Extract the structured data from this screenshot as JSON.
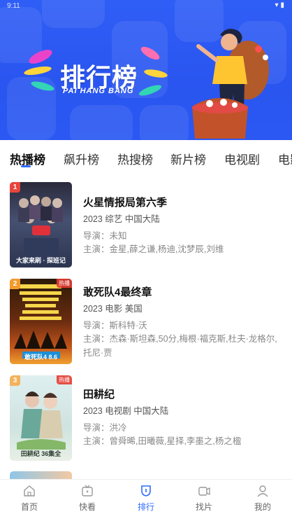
{
  "status_bar": {
    "time": "9:11"
  },
  "banner": {
    "title": "排行榜",
    "subtitle": "PAI HANG BANG"
  },
  "tabs": [
    {
      "label": "热播榜",
      "active": true
    },
    {
      "label": "飙升榜",
      "active": false
    },
    {
      "label": "热搜榜",
      "active": false
    },
    {
      "label": "新片榜",
      "active": false
    },
    {
      "label": "电视剧",
      "active": false
    },
    {
      "label": "电影",
      "active": false
    }
  ],
  "items": [
    {
      "rank": "1",
      "title": "火星情报局第六季",
      "meta": "2023  综艺  中国大陆",
      "director": "导演：未知",
      "cast": "主演：金星,薛之谦,杨迪,沈梦辰,刘维",
      "poster_caption": "大家来刷 · 探班记",
      "badge": ""
    },
    {
      "rank": "2",
      "title": "敢死队4最终章",
      "meta": "2023  电影  美国",
      "director": "导演：斯科特·沃",
      "cast": "主演：杰森·斯坦森,50分,梅根·福克斯,杜夫·龙格尔,托尼·贾",
      "poster_caption": "敢死队4 8.6",
      "badge": "热播"
    },
    {
      "rank": "3",
      "title": "田耕纪",
      "meta": "2023  电视剧  中国大陆",
      "director": "导演：洪冷",
      "cast": "主演：曾舜晞,田曦薇,星择,李墨之,杨之楹",
      "poster_caption": "田耕纪  36集全",
      "badge": "热播"
    }
  ],
  "bottom_nav": [
    {
      "label": "首页",
      "icon": "home-icon",
      "active": false
    },
    {
      "label": "快看",
      "icon": "tv-icon",
      "active": false
    },
    {
      "label": "排行",
      "icon": "ranking-icon",
      "active": true
    },
    {
      "label": "找片",
      "icon": "film-icon",
      "active": false
    },
    {
      "label": "我的",
      "icon": "user-icon",
      "active": false
    }
  ],
  "colors": {
    "accent": "#2f6bff",
    "banner": "#2f5ef6",
    "rank1": "#e8453c",
    "rank2": "#f39a2b",
    "rank3": "#f4b25c"
  }
}
